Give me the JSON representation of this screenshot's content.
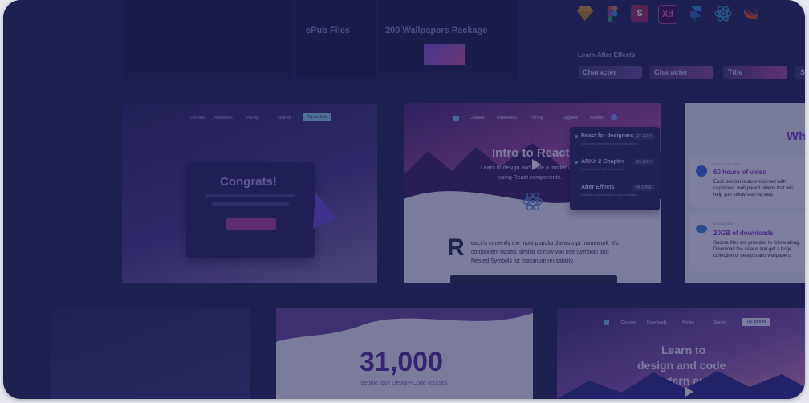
{
  "top_left": {
    "epub_title": "ePub Files",
    "wallpapers_title": "200 Wallpapers Package"
  },
  "tools": {
    "icons": [
      "sketch-icon",
      "figma-icon",
      "s-icon",
      "xd-icon",
      "framer-icon",
      "react-icon",
      "swift-icon"
    ],
    "s_label": "S",
    "xd_label": "Xd"
  },
  "after_effects": {
    "heading": "Learn After Effects",
    "pills": [
      "Character",
      "Character",
      "Title",
      "S"
    ]
  },
  "congrats_card": {
    "nav": [
      "Courses",
      "Downloads",
      "Pricing",
      "Sign in"
    ],
    "cta": "Try for free",
    "title": "Congrats!"
  },
  "react_card": {
    "nav": [
      "Courses",
      "Downloads",
      "Pricing",
      "Upgrade",
      "Account"
    ],
    "title": "Intro to React",
    "subtitle_line1": "Learn to design and code a modern",
    "subtitle_line2": "using React components.",
    "dropdown": [
      {
        "title": "React for designers",
        "badge": "24 JULY",
        "desc": "Get started learning React for designing"
      },
      {
        "title": "ARKit 2 Chapter",
        "badge": "24 JULY",
        "desc": "Learn to build AR experiences"
      },
      {
        "title": "After Effects",
        "badge": "24 JUNE",
        "desc": "A simple course to teach you the basics"
      }
    ],
    "dropcap": "R",
    "body_line1": "eact is currently the most popular Javascript framework. It's",
    "body_line2": "component-based, similar to how you use Symbols and",
    "body_line3": "Nested Symbols for maximum reusability."
  },
  "features_card": {
    "title": "Wh",
    "feature1": {
      "kicker": "WATCH ANYTIME",
      "title": "60 hours of video",
      "line1": "Each section is accompanied with",
      "line2": "captioned, well-paced videos that will",
      "line3": "help you follow step by step."
    },
    "feature2": {
      "kicker": "DOWNLOADS",
      "title": "20GB of downloads",
      "line1": "Source files are provided to follow along.",
      "line2": "Download the videos and get a huge",
      "line3": "collection of designs and wallpapers."
    }
  },
  "stats_card": {
    "number": "31,000",
    "caption": "people took Design+Code courses"
  },
  "landing_card": {
    "nav": [
      "Courses",
      "Downloads",
      "Pricing",
      "Sign in"
    ],
    "cta": "Try for free",
    "title_line1": "Learn to",
    "title_line2": "design and code",
    "title_line3": "modern apps"
  },
  "colors": {
    "overlay": "#1a1c4e",
    "accent_purple": "#9a3ad8",
    "accent_blue": "#3b6fe0",
    "page_bg": "#232654"
  }
}
